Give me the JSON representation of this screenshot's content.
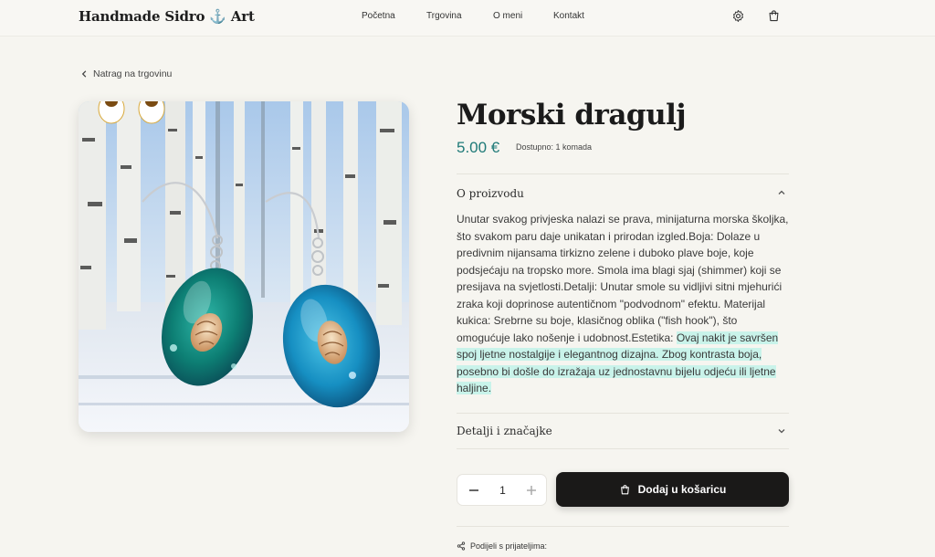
{
  "header": {
    "logo_text": "Handmade Sidro",
    "logo_anchor": "⚓",
    "logo_suffix": "Art",
    "nav": [
      "Početna",
      "Trgovina",
      "O meni",
      "Kontakt"
    ]
  },
  "back_link": "Natrag na trgovinu",
  "product": {
    "title": "Morski dragulj",
    "price": "5.00 €",
    "stock": "Dostupno: 1 komada",
    "about_title": "O proizvodu",
    "description": "Unutar svakog privjeska nalazi se prava, minijaturna morska školjka, što svakom paru daje unikatan i prirodan izgled.Boja: Dolaze u predivnim nijansama tirkizno zelene i duboko plave boje, koje podsjećaju na tropsko more. Smola ima blagi sjaj (shimmer) koji se presijava na svjetlosti.Detalji: Unutar smole su vidljivi sitni mjehurići zraka koji doprinose autentičnom \"podvodnom\" efektu. Materijal kukica: Srebrne su boje, klasičnog oblika (\"fish hook\"), što omogućuje lako nošenje i udobnost.Estetika: ",
    "description_highlight": "Ovaj nakit je savršen spoj ljetne nostalgije i elegantnog dizajna. Zbog kontrasta boja, posebno bi došle do izražaja uz jednostavnu bijelu odjeću ili ljetne haljine.",
    "details_title": "Detalji i značajke",
    "quantity": "1",
    "add_to_cart": "Dodaj u košaricu",
    "share": "Podijeli s prijateljima:"
  },
  "colors": {
    "accent": "#1f7a78",
    "button": "#1a1918",
    "highlight": "#c9f3ea"
  }
}
